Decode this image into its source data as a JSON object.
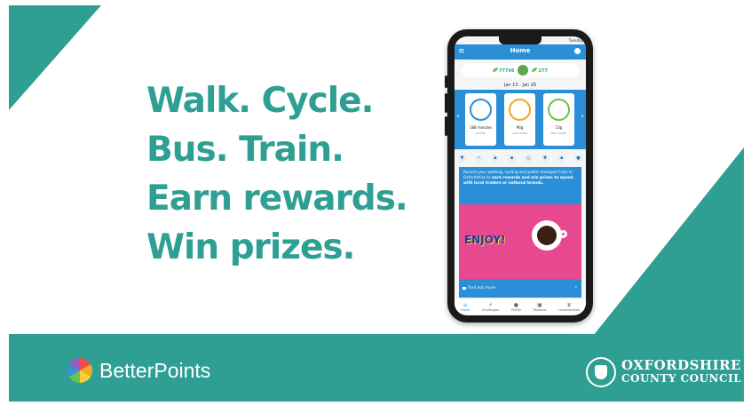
{
  "tagline": [
    "Walk. Cycle.",
    "Bus. Train.",
    "Earn rewards.",
    "Win prizes."
  ],
  "colors": {
    "teal": "#2f9f94",
    "app_blue": "#2a8fd6",
    "promo_pink": "#e8488f"
  },
  "brand_left": {
    "name": "BetterPoints",
    "icon": "pinwheel-logo-icon"
  },
  "brand_right": {
    "line1": "OXFORDSHIRE",
    "line2": "COUNTY COUNCIL",
    "icon": "council-crest-icon"
  },
  "phone": {
    "status_time": "Tuesday",
    "app_title": "Home",
    "points_left": "77745",
    "points_right": "277",
    "date_range": "Jan 13 - Jan 26",
    "cards": [
      {
        "value": "188 minutes",
        "unit": "ACTIVE",
        "icon": "runner-icon"
      },
      {
        "value": "96g",
        "unit": "CO2 SAVED",
        "icon": "leaf-icon"
      },
      {
        "value": "23g",
        "unit": "NO2 SAVED",
        "icon": "tree-icon"
      }
    ],
    "filter_icons": [
      "filter-icon",
      "walk-icon",
      "bus-icon",
      "train-icon",
      "cycle-icon",
      "car-icon",
      "calendar-icon",
      "medal-icon"
    ],
    "promo_text_plain": "Record your walking, cycling and public transport trips in Oxfordshire to ",
    "promo_text_bold": "earn rewards and win prizes to spend with local traders or national brands.",
    "promo_image_text": "ENJOY!",
    "find_out_more": "Find out more",
    "tabs": [
      {
        "label": "Home",
        "icon": "home-icon",
        "active": true
      },
      {
        "label": "Challenges",
        "icon": "lightning-icon",
        "active": false
      },
      {
        "label": "Profile",
        "icon": "person-icon",
        "active": false
      },
      {
        "label": "Rewards",
        "icon": "gift-icon",
        "active": false
      },
      {
        "label": "Leaderboards",
        "icon": "trophy-icon",
        "active": false
      }
    ]
  }
}
